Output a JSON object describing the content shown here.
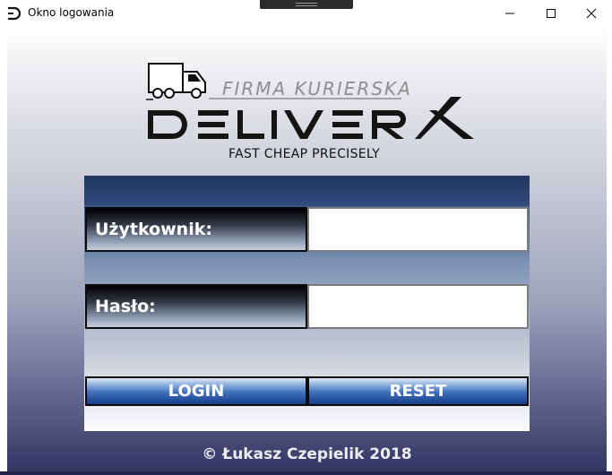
{
  "window": {
    "title": "Okno logowania",
    "app_icon": "deliverx-d-icon",
    "controls": [
      "minimize-icon",
      "maximize-icon",
      "close-icon"
    ]
  },
  "logo": {
    "tagline": "FIRMA KURIERSKA",
    "brand": "DELIVERX",
    "slogan": "FAST CHEAP PRECISELY",
    "icon": "truck-icon"
  },
  "form": {
    "user_label": "Użytkownik:",
    "user_value": "",
    "password_label": "Hasło:",
    "password_value": "",
    "login_label": "LOGIN",
    "reset_label": "RESET"
  },
  "footer": {
    "copyright": "© Łukasz Czepielik 2018"
  },
  "colors": {
    "panel_top": "#283f6e",
    "button_blue": "#3f6fbb",
    "background_bottom": "#333562"
  }
}
